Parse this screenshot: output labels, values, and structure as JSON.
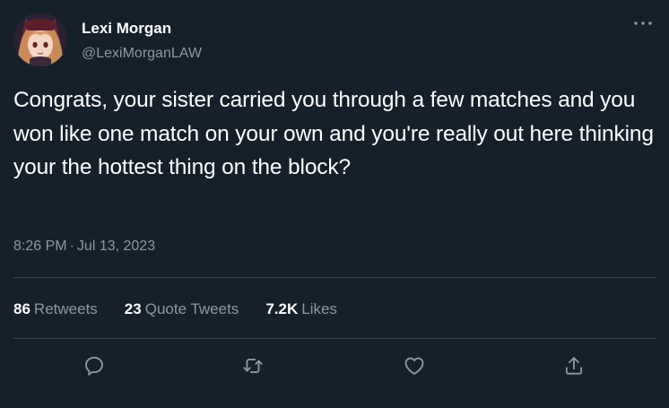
{
  "author": {
    "display_name": "Lexi Morgan",
    "handle": "@LexiMorganLAW"
  },
  "tweet": {
    "text": "Congrats, your sister carried you through a few matches and you won like one match on your own and you're really out here thinking your the hottest thing on the block?",
    "time": "8:26 PM",
    "separator": "·",
    "date": "Jul 13, 2023"
  },
  "stats": {
    "retweets_count": "86",
    "retweets_label": "Retweets",
    "quotes_count": "23",
    "quotes_label": "Quote Tweets",
    "likes_count": "7.2K",
    "likes_label": "Likes"
  },
  "icons": {
    "more": "more-horizontal-icon",
    "reply": "reply-icon",
    "retweet": "retweet-icon",
    "like": "heart-icon",
    "share": "share-icon"
  },
  "colors": {
    "background": "#15202b",
    "primary_text": "#ffffff",
    "secondary_text": "#8b98a5",
    "divider": "#38444d"
  }
}
